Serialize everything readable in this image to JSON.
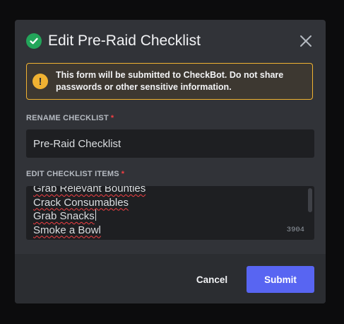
{
  "modal": {
    "title": "Edit Pre-Raid Checklist",
    "title_icon": "check-circle-icon",
    "close_icon": "close-icon"
  },
  "notice": {
    "icon": "warning-icon",
    "icon_glyph": "!",
    "text_pre": "This form will be submitted to ",
    "app_name": "CheckBot",
    "text_post": ". Do not share passwords or other sensitive information.",
    "border_color": "#f0b232"
  },
  "rename": {
    "label": "Rename Checklist",
    "required_mark": "*",
    "value": "Pre-Raid Checklist"
  },
  "items": {
    "label": "Edit Checklist Items",
    "required_mark": "*",
    "lines": [
      "Grab Relevant Bounties",
      "Crack Consumables",
      "Grab Snacks",
      "Smoke a Bowl"
    ],
    "char_count": "3904"
  },
  "footer": {
    "cancel_label": "Cancel",
    "submit_label": "Submit",
    "submit_color": "#5865f2"
  }
}
